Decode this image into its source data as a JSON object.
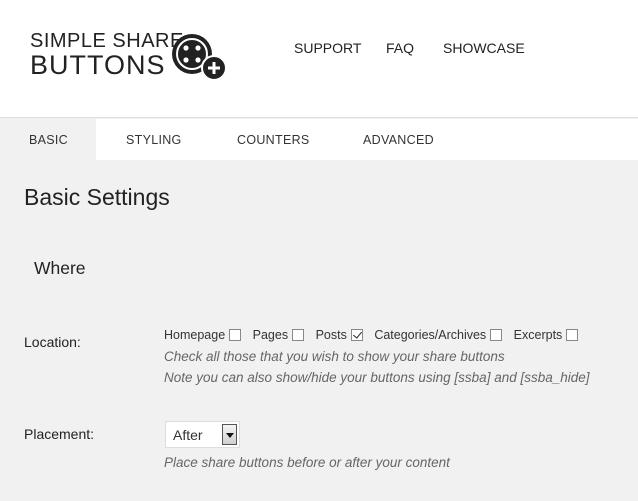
{
  "brand": {
    "line1": "SIMPLE SHARE",
    "line2": "BUTTONS"
  },
  "topnav": {
    "support": "SUPPORT",
    "faq": "FAQ",
    "showcase": "SHOWCASE"
  },
  "tabs": {
    "basic": "BASIC",
    "styling": "STYLING",
    "counters": "COUNTERS",
    "advanced": "ADVANCED",
    "active": "BASIC"
  },
  "page_title": "Basic Settings",
  "section_title": "Where",
  "location": {
    "label": "Location:",
    "options": {
      "homepage": {
        "label": "Homepage",
        "checked": false
      },
      "pages": {
        "label": "Pages",
        "checked": false
      },
      "posts": {
        "label": "Posts",
        "checked": true
      },
      "categories": {
        "label": "Categories/Archives",
        "checked": false
      },
      "excerpts": {
        "label": "Excerpts",
        "checked": false
      }
    },
    "hint1": "Check all those that you wish to show your share buttons",
    "hint2": "Note you can also show/hide your buttons using [ssba] and [ssba_hide]"
  },
  "placement": {
    "label": "Placement:",
    "value": "After",
    "hint": "Place share buttons before or after your content"
  },
  "colors": {
    "header_bg": "#ffffff",
    "content_bg": "#f1f1f1",
    "text": "#222222",
    "hint": "#666666"
  }
}
